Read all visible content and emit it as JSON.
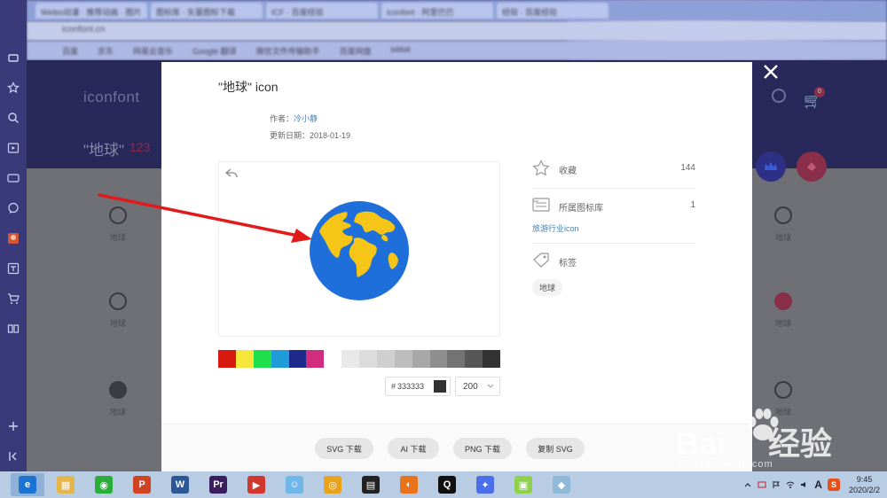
{
  "browser": {
    "tabs": [
      "Weibo动漫 · 推荐动画 · 图片",
      "图标库 · 矢量图标下载",
      "ICF · 百度经验",
      "iconfont · 阿里巴巴",
      "经验 · 百度经验"
    ],
    "address": "iconfont.cn",
    "bookmarks": [
      "百度",
      "京东",
      "网易云音乐",
      "Google 翻译",
      "微信文件传输助手",
      "百度网盘",
      "bilibili"
    ]
  },
  "background_page": {
    "logo": "iconfont",
    "search_title": "\"地球\"",
    "result_count": "123",
    "item_label": "地球",
    "cart_badge": "0"
  },
  "modal": {
    "title": "\"地球\" icon",
    "author_label": "作者：",
    "author_name": "冷小静",
    "date_label": "更新日期：",
    "date": "2018-01-19",
    "hex_hash": "#",
    "hex_value": "333333",
    "size_value": "200",
    "palette": [
      "#d8190f",
      "#f7e63a",
      "#1fe04a",
      "#1e9bd9",
      "#1d2a8a",
      "#d12c7d",
      "#ffffff",
      "#e9e9e9",
      "#dcdcdc",
      "#cfcfcf",
      "#bdbdbd",
      "#a8a8a8",
      "#8e8e8e",
      "#737373",
      "#565656",
      "#333333"
    ],
    "globe_colors": {
      "ocean": "#1e6fd9",
      "land": "#f5c518"
    },
    "info": {
      "collect_label": "收藏",
      "collect_count": "144",
      "library_label": "所属图标库",
      "library_count": "1",
      "library_name": "旅游行业icon",
      "tags_label": "标签",
      "tag": "地球"
    },
    "buttons": {
      "svg": "SVG 下载",
      "ai": "AI 下载",
      "png": "PNG 下载",
      "copy_svg": "复制 SVG"
    }
  },
  "watermark": {
    "brand_left": "Bai",
    "brand_right": "经验",
    "url": "jingyan.baidu.com"
  },
  "taskbar": {
    "apps": [
      {
        "name": "360-browser",
        "color": "#1d73d1",
        "glyph": "e"
      },
      {
        "name": "file-explorer",
        "color": "#e6b54a",
        "glyph": "▦"
      },
      {
        "name": "wechat",
        "color": "#2aae3a",
        "glyph": "◉"
      },
      {
        "name": "powerpoint",
        "color": "#d04424",
        "glyph": "P"
      },
      {
        "name": "word",
        "color": "#2b5797",
        "glyph": "W"
      },
      {
        "name": "premiere",
        "color": "#3a1e5e",
        "glyph": "Pr"
      },
      {
        "name": "media-player",
        "color": "#d0382e",
        "glyph": "▶"
      },
      {
        "name": "baby-app",
        "color": "#6fb7e8",
        "glyph": "☺"
      },
      {
        "name": "chrome",
        "color": "#e8a21b",
        "glyph": "◎"
      },
      {
        "name": "video-editor",
        "color": "#222222",
        "glyph": "▤"
      },
      {
        "name": "orange-app",
        "color": "#e8731b",
        "glyph": "◐"
      },
      {
        "name": "qq",
        "color": "#111111",
        "glyph": "Q"
      },
      {
        "name": "feishu",
        "color": "#4a6fe8",
        "glyph": "✦"
      },
      {
        "name": "notes",
        "color": "#8fd14f",
        "glyph": "▣"
      },
      {
        "name": "edit-app",
        "color": "#8fb8d9",
        "glyph": "◆"
      }
    ],
    "time": "9:45",
    "date": "2020/2/2",
    "ime": "A",
    "sogou": "S"
  }
}
